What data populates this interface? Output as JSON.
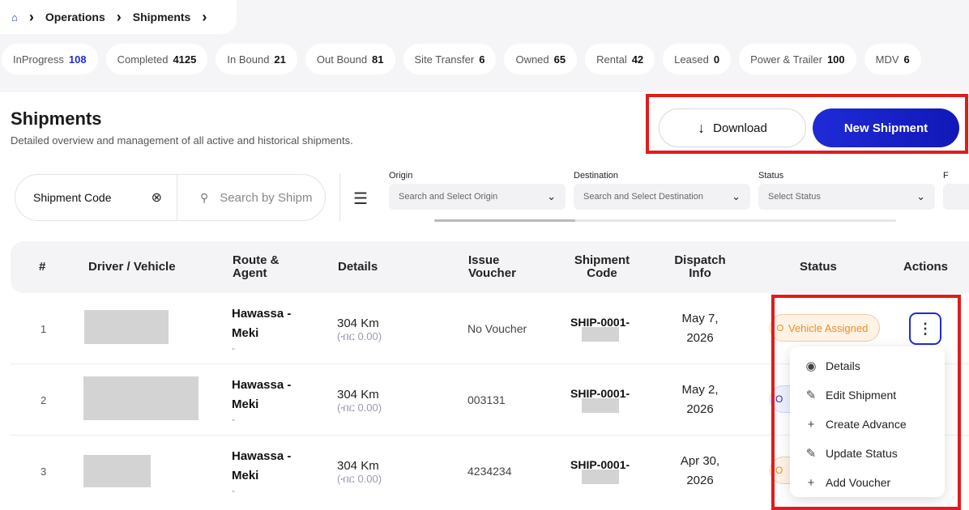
{
  "breadcrumb": {
    "home_icon": "home-icon",
    "items": [
      "Operations",
      "Shipments"
    ]
  },
  "chips": [
    {
      "label": "InProgress",
      "count": "108",
      "active": true
    },
    {
      "label": "Completed",
      "count": "4125"
    },
    {
      "label": "In Bound",
      "count": "21"
    },
    {
      "label": "Out Bound",
      "count": "81"
    },
    {
      "label": "Site Transfer",
      "count": "6"
    },
    {
      "label": "Owned",
      "count": "65"
    },
    {
      "label": "Rental",
      "count": "42"
    },
    {
      "label": "Leased",
      "count": "0"
    },
    {
      "label": "Power & Trailer",
      "count": "100"
    },
    {
      "label": "MDV",
      "count": "6"
    }
  ],
  "header": {
    "title": "Shipments",
    "subtitle": "Detailed overview and management of all active and historical shipments.",
    "download_label": "Download",
    "new_label": "New Shipment"
  },
  "search": {
    "field": "Shipment Code",
    "placeholder": "Search by Shipm"
  },
  "filters": {
    "origin": {
      "label": "Origin",
      "placeholder": "Search and Select Origin"
    },
    "destination": {
      "label": "Destination",
      "placeholder": "Search and Select Destination"
    },
    "status": {
      "label": "Status",
      "placeholder": "Select Status"
    },
    "extra": {
      "label": "F"
    }
  },
  "table": {
    "headers": {
      "num": "#",
      "driver": "Driver / Vehicle",
      "route": "Route & Agent",
      "details": "Details",
      "voucher": "Issue Voucher",
      "code": "Shipment Code",
      "dispatch": "Dispatch Info",
      "status": "Status",
      "actions": "Actions"
    },
    "rows": [
      {
        "num": "1",
        "route": "Hawassa - Meki",
        "agent": "-",
        "km": "304 Km",
        "money": "(ብር 0.00)",
        "voucher": "No Voucher",
        "code": "SHIP-0001-",
        "date1": "May 7,",
        "date2": "2026",
        "status": "Vehicle Assigned"
      },
      {
        "num": "2",
        "route": "Hawassa - Meki",
        "agent": "-",
        "km": "304 Km",
        "money": "(ብር 0.00)",
        "voucher": "003131",
        "code": "SHIP-0001-",
        "date1": "May 2,",
        "date2": "2026",
        "status": "O"
      },
      {
        "num": "3",
        "route": "Hawassa - Meki",
        "agent": "-",
        "km": "304 Km",
        "money": "(ብር 0.00)",
        "voucher": "4234234",
        "code": "SHIP-0001-",
        "date1": "Apr 30,",
        "date2": "2026",
        "status": "O"
      }
    ]
  },
  "menu": {
    "items": [
      {
        "label": "Details",
        "icon": "eye-icon"
      },
      {
        "label": "Edit Shipment",
        "icon": "edit-icon"
      },
      {
        "label": "Create Advance",
        "icon": "plus-icon"
      },
      {
        "label": "Update Status",
        "icon": "edit-icon"
      },
      {
        "label": "Add Voucher",
        "icon": "plus-icon"
      }
    ]
  },
  "colors": {
    "accent": "#1f2bd6",
    "highlight": "#e21b1b",
    "status_orange": "#f08c24"
  }
}
